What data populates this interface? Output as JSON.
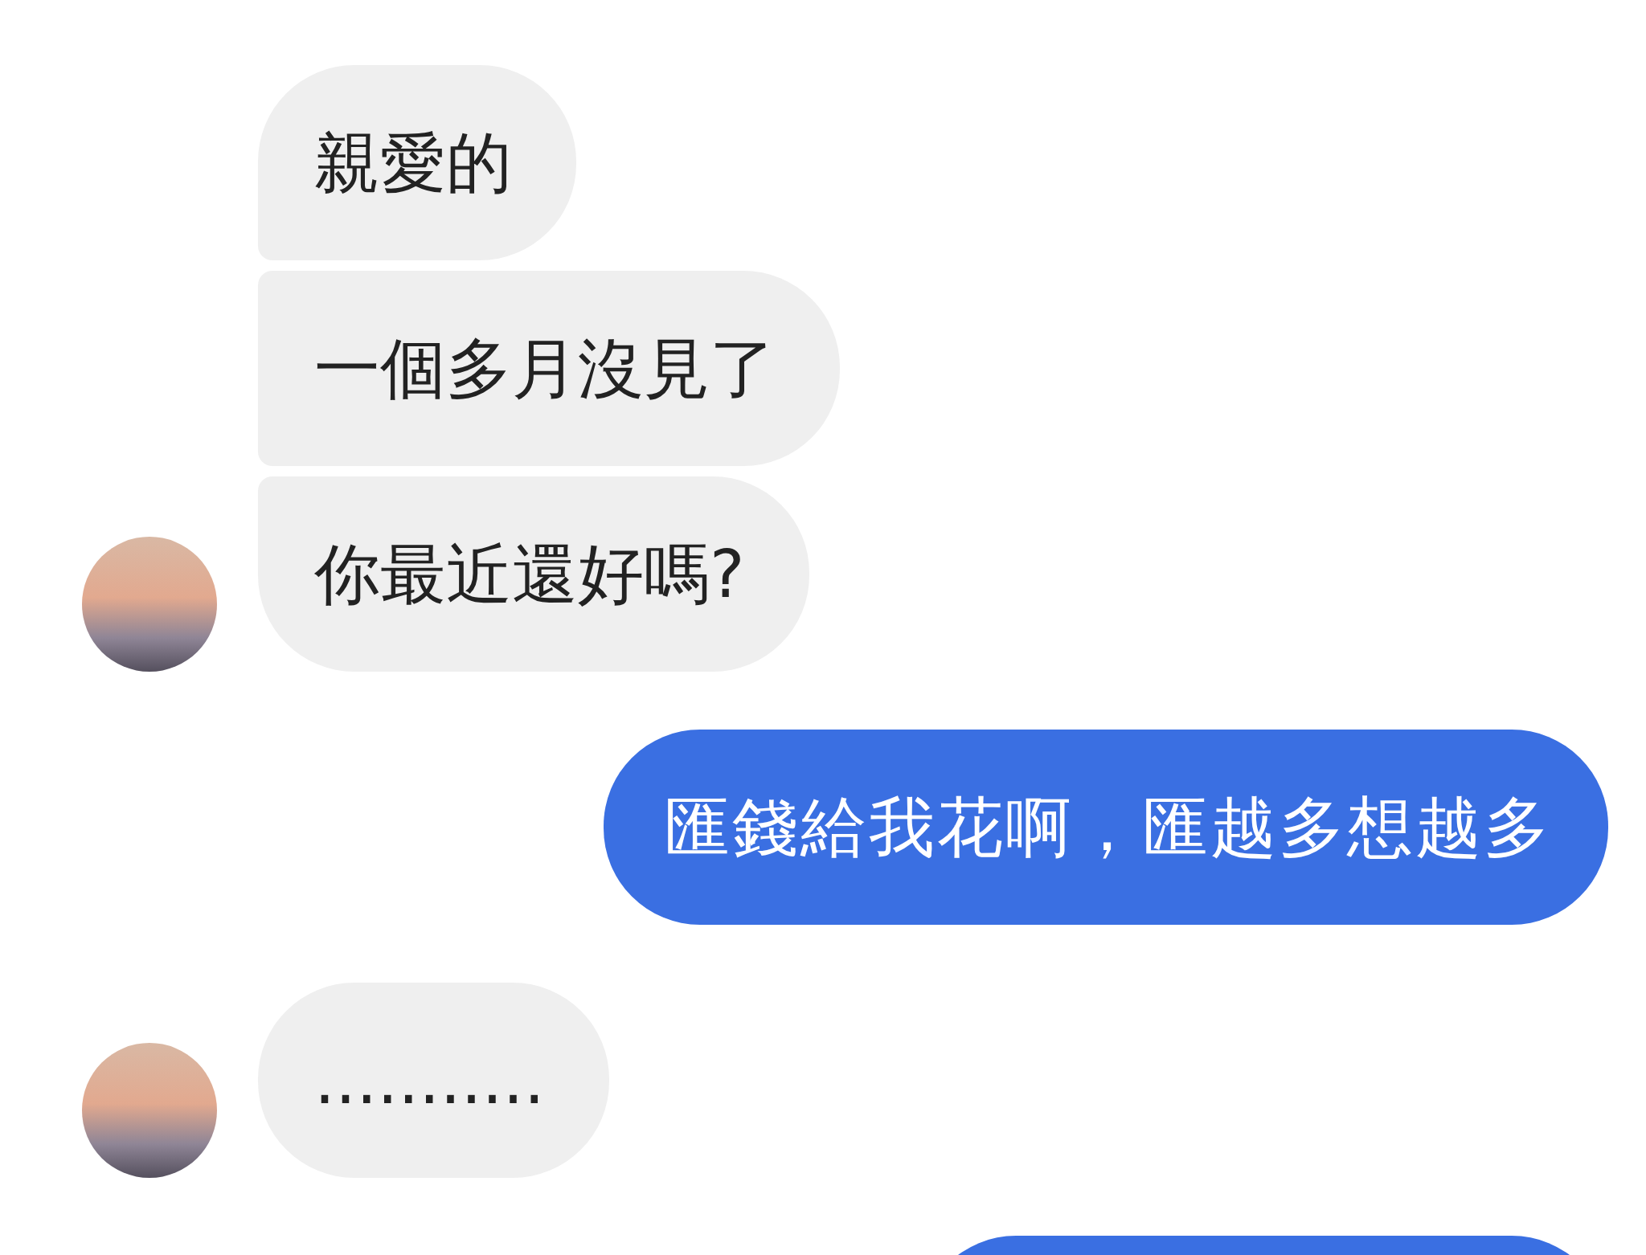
{
  "messages": [
    {
      "kind": "received",
      "bubbles": [
        "親愛的",
        "一個多月沒見了",
        "你最近還好嗎?"
      ]
    },
    {
      "kind": "sent",
      "bubbles": [
        "匯錢給我花啊，匯越多想越多"
      ]
    },
    {
      "kind": "received",
      "bubbles": [
        "..........."
      ]
    },
    {
      "kind": "sent"
    }
  ]
}
